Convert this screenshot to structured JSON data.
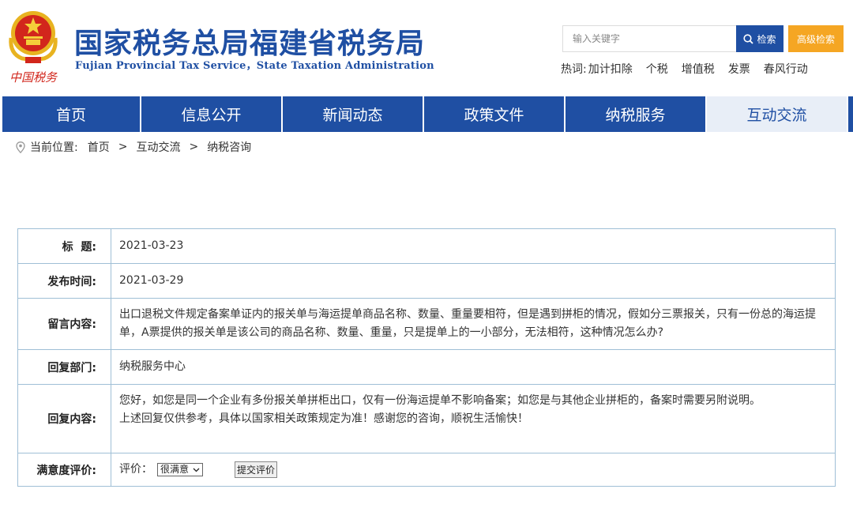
{
  "header": {
    "title_cn": "国家税务总局福建省税务局",
    "title_en": "Fujian Provincial Tax Service，State Taxation Administration",
    "emblem_caption": "中国税务",
    "search": {
      "placeholder": "输入关键字",
      "button_label": "检索",
      "advanced_label": "高级检索"
    },
    "hotwords": {
      "label": "热词:",
      "items": [
        "加计扣除",
        "个税",
        "增值税",
        "发票",
        "春风行动"
      ]
    }
  },
  "nav": {
    "items": [
      "首页",
      "信息公开",
      "新闻动态",
      "政策文件",
      "纳税服务",
      "互动交流"
    ],
    "active_index": 5
  },
  "breadcrumb": {
    "label": "当前位置:",
    "items": [
      "首页",
      "互动交流",
      "纳税咨询"
    ]
  },
  "detail": {
    "title_label": "标  题:",
    "title_value": "2021-03-23",
    "publish_label": "发布时间:",
    "publish_value": "2021-03-29",
    "message_label": "留言内容:",
    "message_value": "出口退税文件规定备案单证内的报关单与海运提单商品名称、数量、重量要相符，但是遇到拼柜的情况，假如分三票报关，只有一份总的海运提单，A票提供的报关单是该公司的商品名称、数量、重量，只是提单上的一小部分，无法相符，这种情况怎么办?",
    "dept_label": "回复部门:",
    "dept_value": "纳税服务中心",
    "reply_label": "回复内容:",
    "reply_line1": "您好，如您是同一个企业有多份报关单拼柜出口，仅有一份海运提单不影响备案；如您是与其他企业拼柜的，备案时需要另附说明。",
    "reply_line2": "上述回复仅供参考，具体以国家相关政策规定为准！感谢您的咨询，顺祝生活愉快！",
    "rating_label": "满意度评价:",
    "rating_prefix": "评价：",
    "rating_selected": "很满意",
    "submit_label": "提交评价"
  },
  "colors": {
    "brand_blue": "#1f4fa3",
    "accent_orange": "#f5a623",
    "active_tab_bg": "#e8eef7",
    "table_border": "#9fbfd6",
    "emblem_red": "#d2261c",
    "emblem_gold": "#e8b320"
  },
  "icons": {
    "emblem": "national-emblem-icon",
    "search": "search-icon",
    "location": "location-pin-icon",
    "dropdown": "chevron-down-icon"
  }
}
